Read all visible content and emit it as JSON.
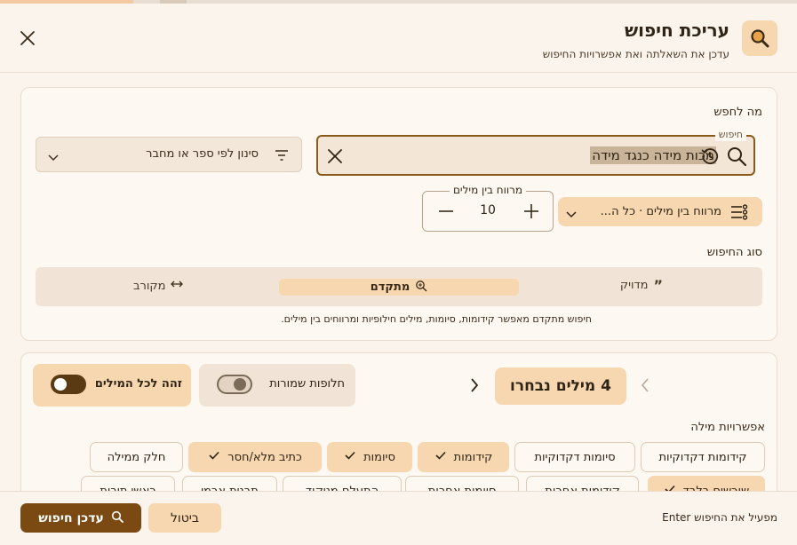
{
  "colors": {
    "accent": "#7a4a12",
    "accent_soft": "#f7d7b0",
    "background": "#fbf4ec",
    "card": "#fdf8f2",
    "border": "#eadcce"
  },
  "header": {
    "title": "עריכת חיפוש",
    "subtitle": "עדכן את השאלתה ואת אפשרויות החיפוש",
    "icon": "search-icon"
  },
  "query": {
    "section_label": "מה לחפש",
    "field_label": "חיפוש",
    "value": "מכות מידה כנגד מידה",
    "filter_placeholder": "סינון לפי ספר או מחבר",
    "distance_pill": "מרווח בין מילים · כל ה...",
    "distance_label": "מרווח בין מילים",
    "distance_value": "10"
  },
  "search_type": {
    "section_label": "סוג החיפוש",
    "options": [
      {
        "label": "מדויק",
        "icon": "quote-icon",
        "active": false
      },
      {
        "label": "מתקדם",
        "icon": "zoom-icon",
        "active": true
      },
      {
        "label": "מקורב",
        "icon": "arrows-icon",
        "active": false
      }
    ],
    "hint": "חיפוש מתקדם מאפשר קידומות, סיומות, מילים חילופיות ומרווחים בין מילים."
  },
  "words": {
    "selected_count": "4 מילים נבחרו",
    "same_for_all_label": "זהה לכל המילים",
    "same_for_all_on": true,
    "saved_alternatives_label": "חלופות שמורות",
    "saved_alternatives_on": false,
    "options_label": "אפשרויות מילה",
    "chips_row1": [
      {
        "label": "קידומות דקדוקיות",
        "on": false
      },
      {
        "label": "סיומות דקדוקיות",
        "on": false
      },
      {
        "label": "קידומות",
        "on": true
      },
      {
        "label": "סיומות",
        "on": true
      },
      {
        "label": "כתיב מלא/חסר",
        "on": true
      },
      {
        "label": "חלק ממילה",
        "on": false
      }
    ],
    "chips_row2": [
      {
        "label": "שורשים בלבד",
        "on": true
      },
      {
        "label": "קידומות אחרות",
        "on": false
      },
      {
        "label": "סיומות אחרות",
        "on": false
      },
      {
        "label": "התעלם מניקוד",
        "on": false
      },
      {
        "label": "תבנית ארמי",
        "on": false
      },
      {
        "label": "ראשי תיבות",
        "on": false
      }
    ]
  },
  "footer": {
    "hint": "Enter מפעיל את החיפוש",
    "cancel": "ביטול",
    "submit": "עדכן חיפוש"
  }
}
